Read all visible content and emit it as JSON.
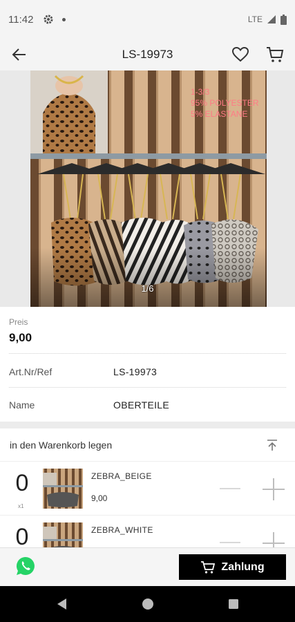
{
  "status_bar": {
    "time": "11:42",
    "network": "LTE"
  },
  "app_bar": {
    "title": "LS-19973"
  },
  "gallery": {
    "counter": "1/6",
    "overlay_lines": [
      "1-3/3",
      "95% POLYESTER",
      "5% ELASTANE"
    ]
  },
  "product": {
    "price_label": "Preis",
    "price_value": "9,00",
    "rows": [
      {
        "label": "Art.Nr/Ref",
        "value": "LS-19973"
      },
      {
        "label": "Name",
        "value": "OBERTEILE"
      }
    ]
  },
  "cart": {
    "title": "in den Warenkorb legen",
    "variants": [
      {
        "qty": "0",
        "qty_mult": "x1",
        "name": "ZEBRA_BEIGE",
        "price": "9,00"
      },
      {
        "qty": "0",
        "qty_mult": "",
        "name": "ZEBRA_WHITE",
        "price": ""
      }
    ]
  },
  "bottom_bar": {
    "pay_label": "Zahlung"
  },
  "icons": {
    "back": "arrow-left-icon",
    "favorite": "heart-icon",
    "cart": "cart-icon",
    "collapse": "collapse-up-icon",
    "whatsapp": "whatsapp-icon"
  },
  "colors": {
    "accent": "#000000",
    "whatsapp": "#25D366",
    "overlay_text": "#ff7a85"
  }
}
